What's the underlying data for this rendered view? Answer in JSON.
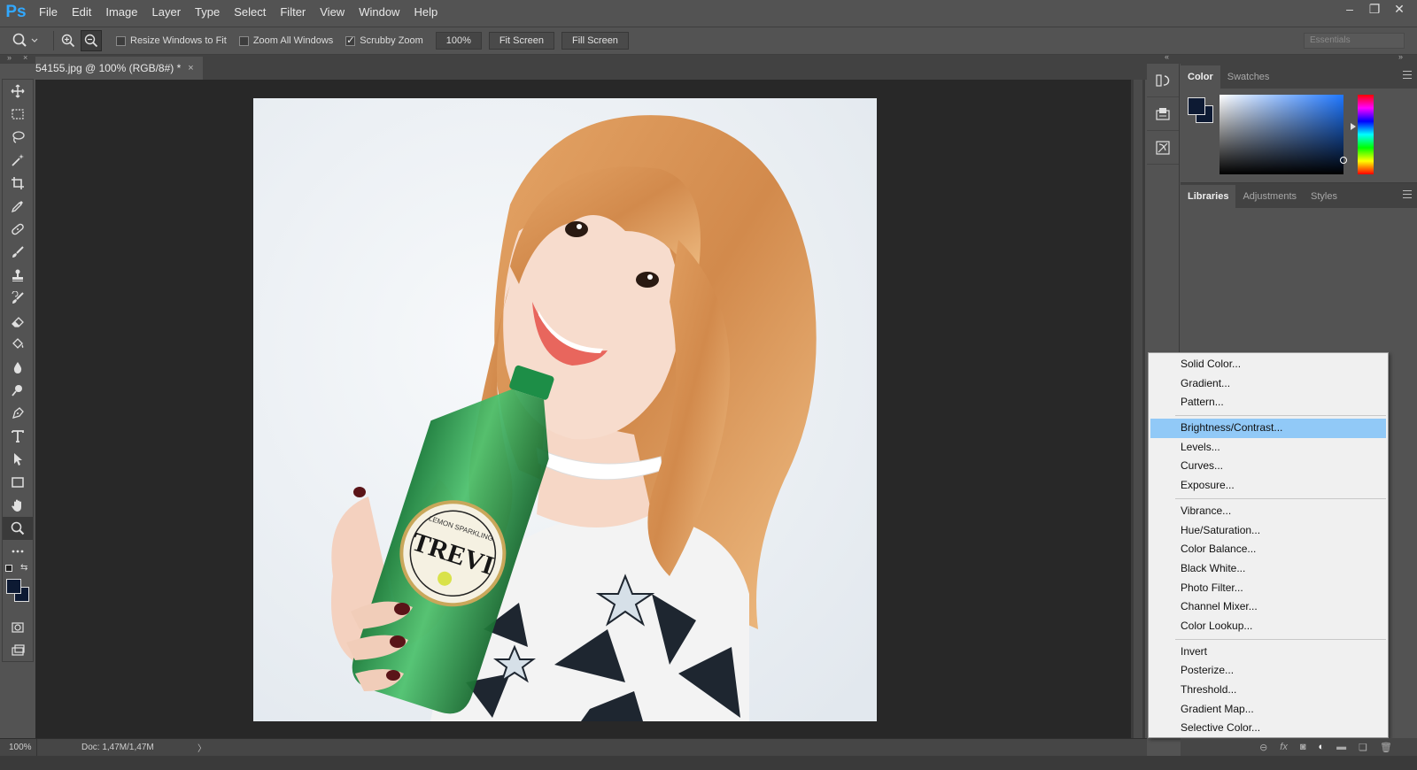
{
  "app": {
    "logo": "Ps",
    "menu": [
      "File",
      "Edit",
      "Image",
      "Layer",
      "Type",
      "Select",
      "Filter",
      "View",
      "Window",
      "Help"
    ],
    "window_controls": [
      "minimize-icon",
      "restore-icon",
      "close-icon"
    ]
  },
  "options": {
    "resize_windows": "Resize Windows to Fit",
    "resize_checked": false,
    "zoom_all": "Zoom All Windows",
    "zoom_all_checked": false,
    "scrubby": "Scrubby Zoom",
    "scrubby_checked": true,
    "zoom_value": "100%",
    "fit_screen": "Fit Screen",
    "fill_screen": "Fill Screen",
    "workspace": "Essentials"
  },
  "document": {
    "tab_title": "54155.jpg @ 100% (RGB/8#) *",
    "close": "×"
  },
  "status": {
    "zoom": "100%",
    "doc": "Doc: 1,47M/1,47M",
    "arrow": "〉"
  },
  "panels": {
    "color_tabs": [
      "Color",
      "Swatches"
    ],
    "library_tabs": [
      "Libraries",
      "Adjustments",
      "Styles"
    ],
    "foreground_color": "#0d1a33"
  },
  "photo": {
    "bottle_label": "TREVI",
    "bottle_sub": "LEMON SPARKLING"
  },
  "adjust_menu": {
    "group1": [
      "Solid Color...",
      "Gradient...",
      "Pattern..."
    ],
    "group2": [
      "Brightness/Contrast...",
      "Levels...",
      "Curves...",
      "Exposure..."
    ],
    "group3": [
      "Vibrance...",
      "Hue/Saturation...",
      "Color Balance...",
      "Black  White...",
      "Photo Filter...",
      "Channel Mixer...",
      "Color Lookup..."
    ],
    "group4": [
      "Invert",
      "Posterize...",
      "Threshold...",
      "Gradient Map...",
      "Selective Color..."
    ],
    "highlighted": "Brightness/Contrast..."
  }
}
